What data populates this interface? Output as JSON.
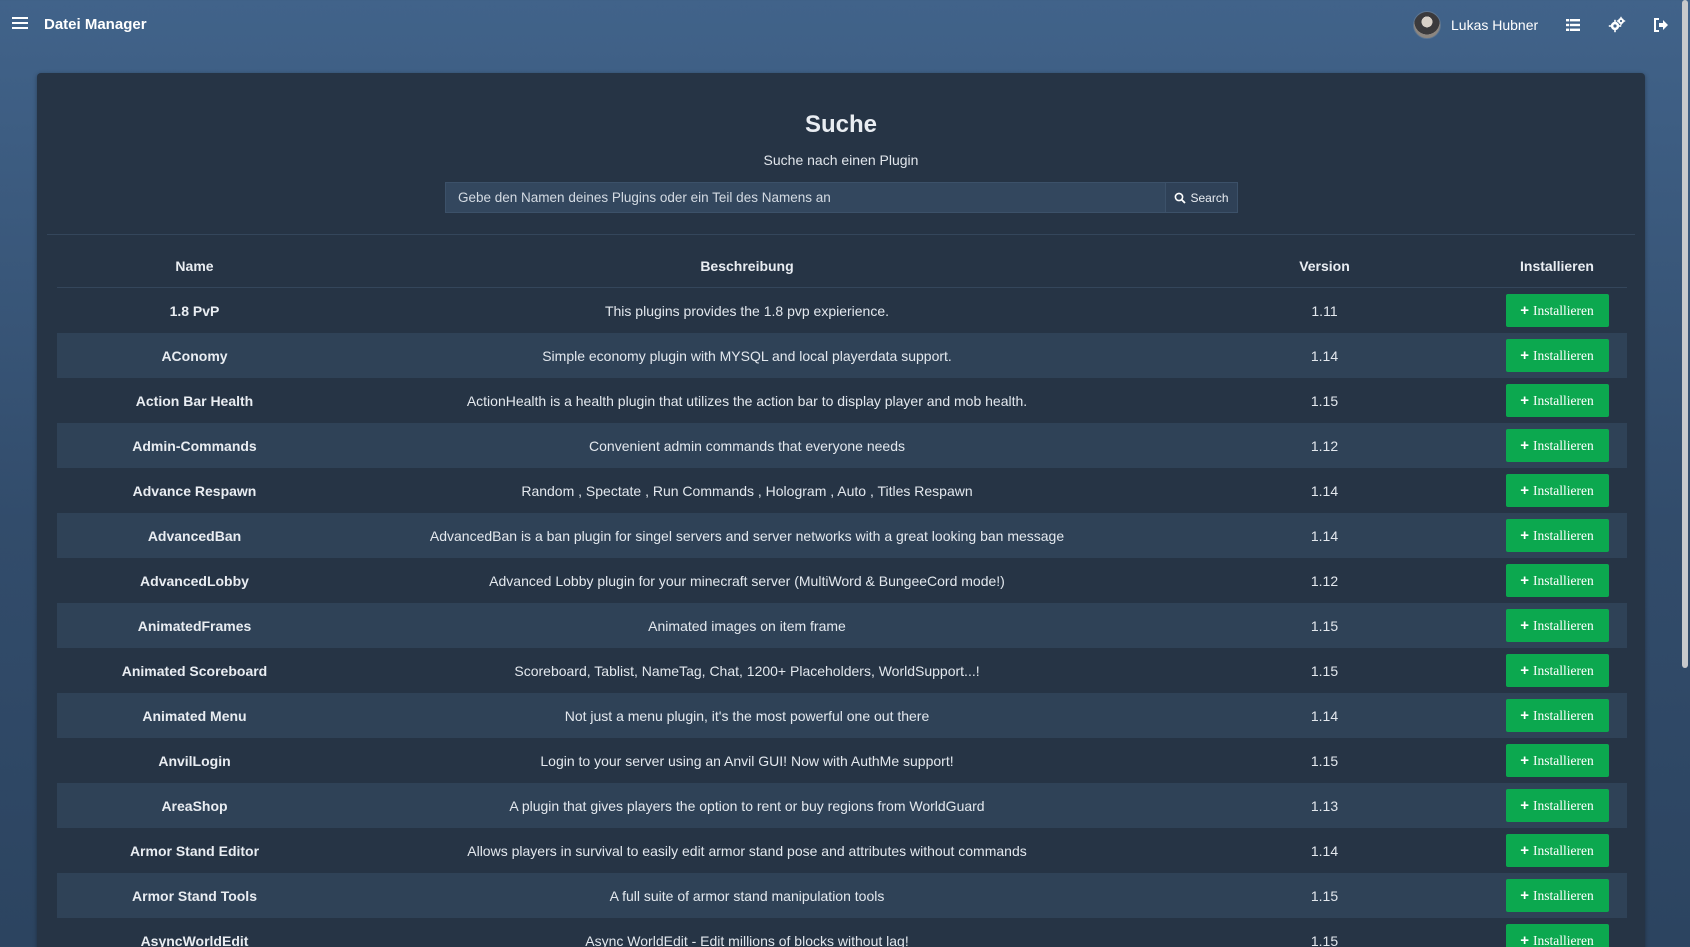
{
  "header": {
    "title": "Datei Manager",
    "user_name": "Lukas Hubner",
    "icons": [
      "menu-icon",
      "list-icon",
      "cogs-icon",
      "logout-icon"
    ]
  },
  "search": {
    "title": "Suche",
    "subtitle": "Suche nach einen Plugin",
    "placeholder": "Gebe den Namen deines Plugins oder ein Teil des Namens an",
    "button_label": "Search"
  },
  "table": {
    "columns": [
      "Name",
      "Beschreibung",
      "Version",
      "Installieren"
    ],
    "install_label": "Installieren",
    "rows": [
      {
        "name": "1.8 PvP",
        "description": "This plugins provides the 1.8 pvp expierience.",
        "version": "1.11"
      },
      {
        "name": "AConomy",
        "description": "Simple economy plugin with MYSQL and local playerdata support.",
        "version": "1.14"
      },
      {
        "name": "Action Bar Health",
        "description": "ActionHealth is a health plugin that utilizes the action bar to display player and mob health.",
        "version": "1.15"
      },
      {
        "name": "Admin-Commands",
        "description": "Convenient admin commands that everyone needs",
        "version": "1.12"
      },
      {
        "name": "Advance Respawn",
        "description": "Random , Spectate , Run Commands , Hologram , Auto , Titles Respawn",
        "version": "1.14"
      },
      {
        "name": "AdvancedBan",
        "description": "AdvancedBan is a ban plugin for singel servers and server networks with a great looking ban message",
        "version": "1.14"
      },
      {
        "name": "AdvancedLobby",
        "description": "Advanced Lobby plugin for your minecraft server (MultiWord & BungeeCord mode!)",
        "version": "1.12"
      },
      {
        "name": "AnimatedFrames",
        "description": "Animated images on item frame",
        "version": "1.15"
      },
      {
        "name": "Animated Scoreboard",
        "description": "Scoreboard, Tablist, NameTag, Chat, 1200+ Placeholders, WorldSupport...!",
        "version": "1.15"
      },
      {
        "name": "Animated Menu",
        "description": "Not just a menu plugin, it's the most powerful one out there",
        "version": "1.14"
      },
      {
        "name": "AnvilLogin",
        "description": "Login to your server using an Anvil GUI! Now with AuthMe support!",
        "version": "1.15"
      },
      {
        "name": "AreaShop",
        "description": "A plugin that gives players the option to rent or buy regions from WorldGuard",
        "version": "1.13"
      },
      {
        "name": "Armor Stand Editor",
        "description": "Allows players in survival to easily edit armor stand pose and attributes without commands",
        "version": "1.14"
      },
      {
        "name": "Armor Stand Tools",
        "description": "A full suite of armor stand manipulation tools",
        "version": "1.15"
      },
      {
        "name": "AsyncWorldEdit",
        "description": "Async WorldEdit - Edit millions of blocks without lag!",
        "version": "1.15"
      }
    ]
  },
  "colors": {
    "background": "#3d5d82",
    "card": "#263445",
    "row_alt": "#2f4257",
    "install_button": "#0ca84f"
  }
}
